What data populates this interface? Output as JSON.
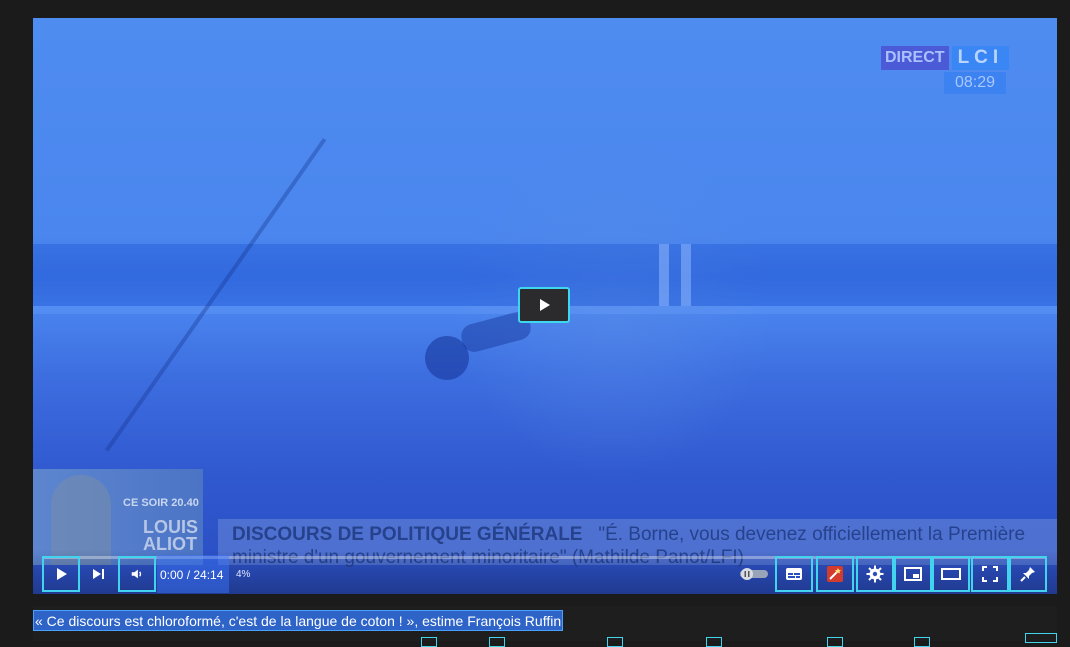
{
  "video": {
    "channel_badge": "DIRECT",
    "channel_logo": "LCI",
    "clock": "08:29",
    "thumbnail": {
      "promo_label": "CE SOIR 20.40",
      "name": "LOUIS ALIOT"
    },
    "lower_third": {
      "headline": "DISCOURS DE POLITIQUE GÉNÉRALE",
      "quote": "\"É. Borne, vous devenez officiellement la Première ministre d'un gouvernement minoritaire\" (Mathilde Panot/LFI)"
    }
  },
  "controls": {
    "current_time": "0:00",
    "separator": " / ",
    "duration": "24:14",
    "buffered_percent": "4%",
    "progress": 0,
    "buttons": {
      "play": "play-icon",
      "next": "next-icon",
      "volume": "volume-icon",
      "autoplay": "autoplay-toggle-icon",
      "subtitles": "subtitles-icon",
      "extension": "extension-icon",
      "settings": "gear-icon",
      "miniplayer": "miniplayer-icon",
      "theater": "theater-icon",
      "fullscreen": "fullscreen-icon",
      "pin": "pin-icon"
    }
  },
  "title": "« Ce discours est chloroformé, c'est de la langue de coton ! », estime François Ruffin",
  "colors": {
    "focus_outline": "#42d3ee",
    "selection": "#2e63c8"
  }
}
